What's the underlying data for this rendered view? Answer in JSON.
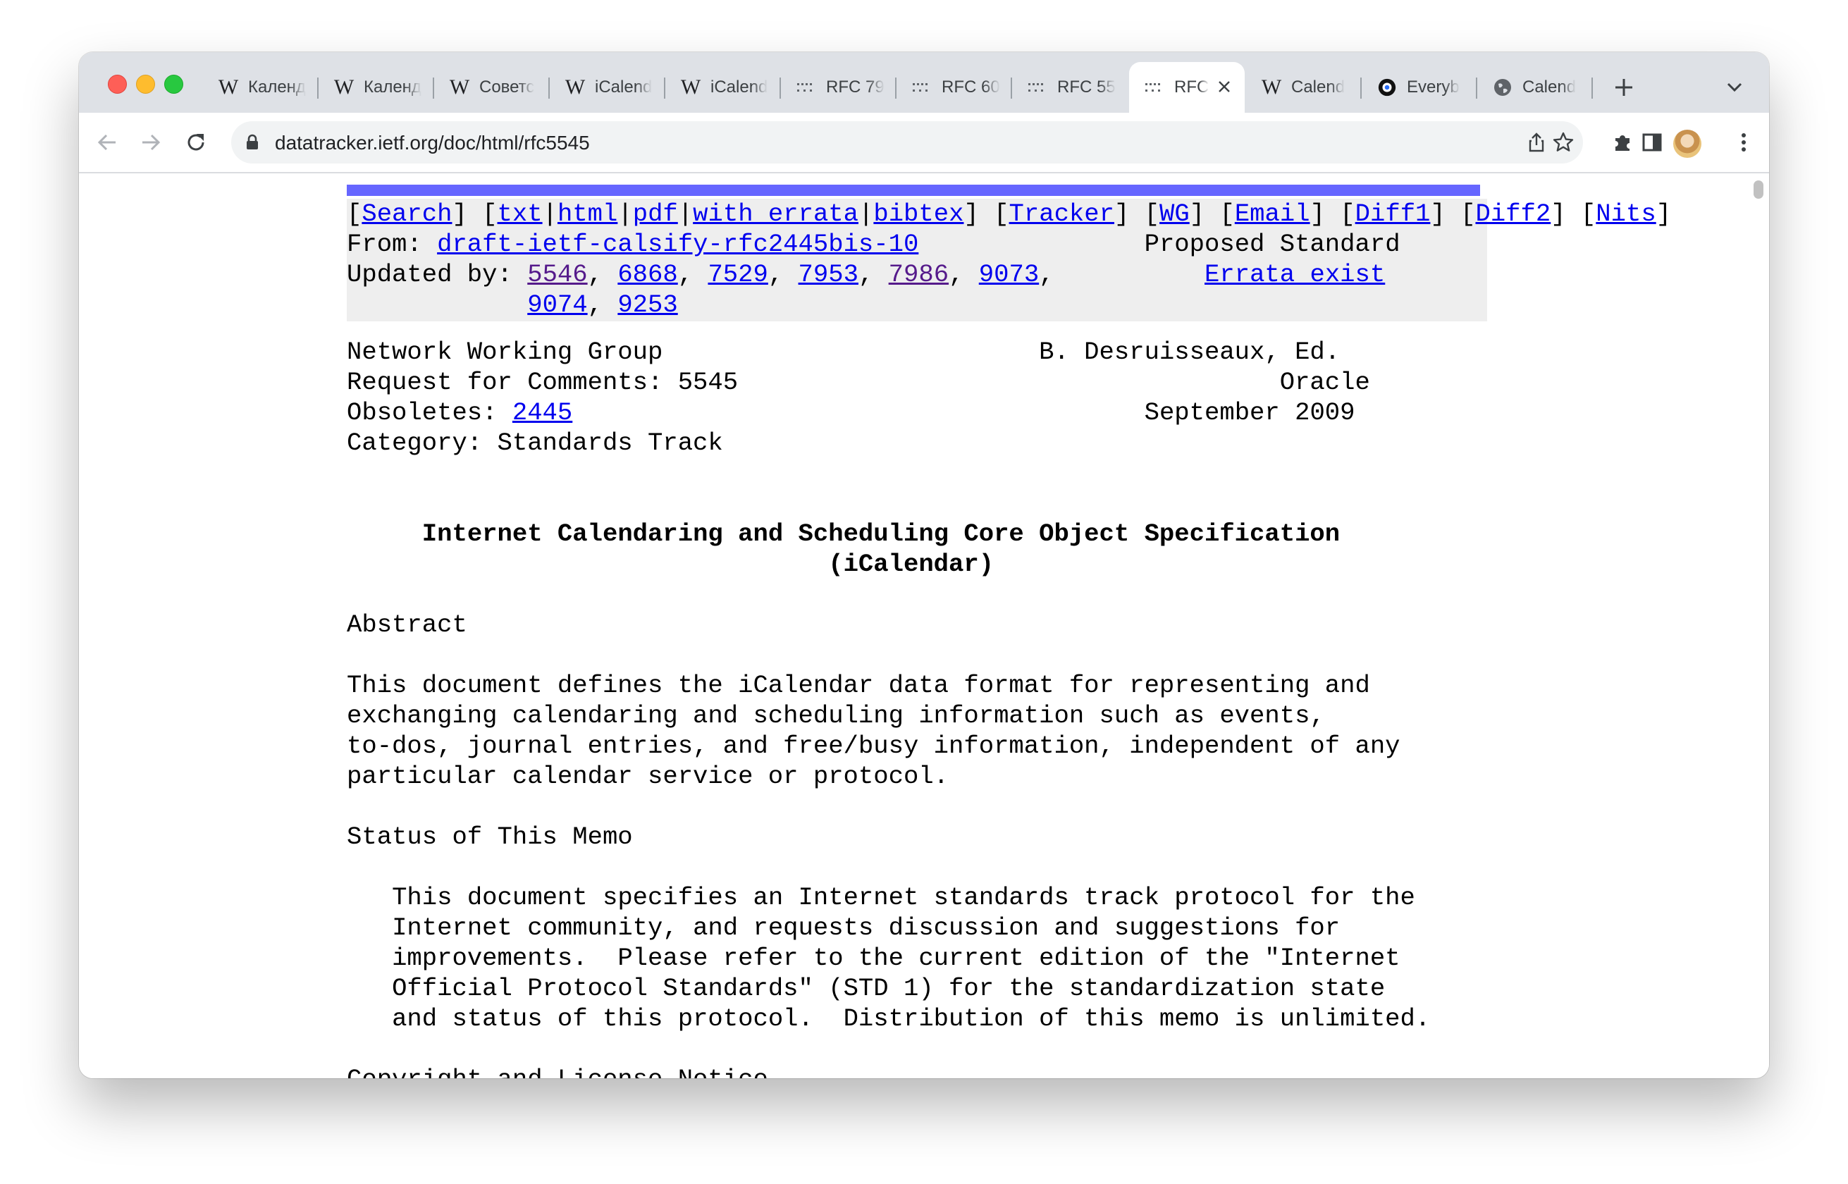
{
  "tabs": [
    {
      "label": "Календ",
      "icon": "wikipedia-icon"
    },
    {
      "label": "Календ",
      "icon": "wikipedia-icon"
    },
    {
      "label": "Советс",
      "icon": "wikipedia-icon"
    },
    {
      "label": "iCalend",
      "icon": "wikipedia-icon"
    },
    {
      "label": "iCalend",
      "icon": "wikipedia-icon"
    },
    {
      "label": "RFC 79",
      "icon": "ietf-icon"
    },
    {
      "label": "RFC 60",
      "icon": "ietf-icon"
    },
    {
      "label": "RFC 55",
      "icon": "ietf-icon"
    },
    {
      "label": "RFC",
      "icon": "ietf-icon",
      "active": true
    },
    {
      "label": "Calend",
      "icon": "wikipedia-icon"
    },
    {
      "label": "Everyb",
      "icon": "everybody-icon"
    },
    {
      "label": "Calend",
      "icon": "globe-icon"
    }
  ],
  "address": {
    "url": "datatracker.ietf.org/doc/html/rfc5545"
  },
  "colors": {
    "tabstrip": "#dee1e6",
    "link": "#0000ee",
    "visited": "#551a8b",
    "topbar": "#6666ff",
    "meta_bg": "#eeeeee"
  },
  "doc": {
    "nav": {
      "search": "Search",
      "txt": "txt",
      "html": "html",
      "pdf": "pdf",
      "with_errata": "with errata",
      "bibtex": "bibtex",
      "tracker": "Tracker",
      "wg": "WG",
      "email": "Email",
      "diff1": "Diff1",
      "diff2": "Diff2",
      "nits": "Nits"
    },
    "from_label": "From: ",
    "from_link": "draft-ietf-calsify-rfc2445bis-10",
    "status": "Proposed Standard",
    "updated_label": "Updated by: ",
    "updated_by": [
      "5546",
      "6868",
      "7529",
      "7953",
      "7986",
      "9073",
      "9074",
      "9253"
    ],
    "errata": "Errata exist",
    "header_left": [
      "Network Working Group",
      "Request for Comments: 5545",
      "Obsoletes: ",
      "Category: Standards Track"
    ],
    "obsoletes": "2445",
    "header_right": [
      "B. Desruisseaux, Ed.",
      "Oracle",
      "September 2009"
    ],
    "title_line1": "Internet Calendaring and Scheduling Core Object Specification",
    "title_line2": "(iCalendar)",
    "abstract_heading": "Abstract",
    "abstract_lines": [
      "This document defines the iCalendar data format for representing and",
      "exchanging calendaring and scheduling information such as events,",
      "to-dos, journal entries, and free/busy information, independent of any",
      "particular calendar service or protocol."
    ],
    "status_heading": "Status of This Memo",
    "status_lines": [
      "This document specifies an Internet standards track protocol for the",
      "Internet community, and requests discussion and suggestions for",
      "improvements.  Please refer to the current edition of the \"Internet",
      "Official Protocol Standards\" (STD 1) for the standardization state",
      "and status of this protocol.  Distribution of this memo is unlimited."
    ],
    "copyright_heading": "Copyright and License Notice"
  }
}
